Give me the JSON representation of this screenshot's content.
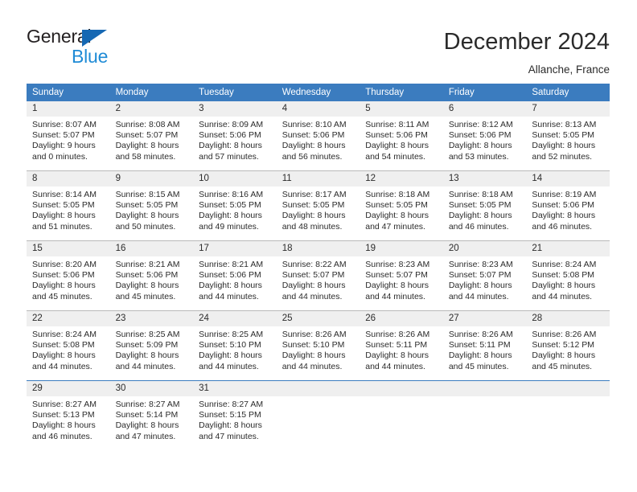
{
  "brand": {
    "name_part1": "General",
    "name_part2": "Blue",
    "accent_color": "#1668b3",
    "accent_color_light": "#1f8bd6"
  },
  "header": {
    "title": "December 2024",
    "location": "Allanche, France"
  },
  "theme": {
    "header_bg": "#3b7cbf",
    "daynum_bg": "#efefef",
    "text": "#2b2b2b",
    "grid_line": "#b9b9b9"
  },
  "weekday_headers": [
    "Sunday",
    "Monday",
    "Tuesday",
    "Wednesday",
    "Thursday",
    "Friday",
    "Saturday"
  ],
  "weeks": [
    [
      {
        "day": "1",
        "sunrise": "Sunrise: 8:07 AM",
        "sunset": "Sunset: 5:07 PM",
        "daylight1": "Daylight: 9 hours",
        "daylight2": "and 0 minutes."
      },
      {
        "day": "2",
        "sunrise": "Sunrise: 8:08 AM",
        "sunset": "Sunset: 5:07 PM",
        "daylight1": "Daylight: 8 hours",
        "daylight2": "and 58 minutes."
      },
      {
        "day": "3",
        "sunrise": "Sunrise: 8:09 AM",
        "sunset": "Sunset: 5:06 PM",
        "daylight1": "Daylight: 8 hours",
        "daylight2": "and 57 minutes."
      },
      {
        "day": "4",
        "sunrise": "Sunrise: 8:10 AM",
        "sunset": "Sunset: 5:06 PM",
        "daylight1": "Daylight: 8 hours",
        "daylight2": "and 56 minutes."
      },
      {
        "day": "5",
        "sunrise": "Sunrise: 8:11 AM",
        "sunset": "Sunset: 5:06 PM",
        "daylight1": "Daylight: 8 hours",
        "daylight2": "and 54 minutes."
      },
      {
        "day": "6",
        "sunrise": "Sunrise: 8:12 AM",
        "sunset": "Sunset: 5:06 PM",
        "daylight1": "Daylight: 8 hours",
        "daylight2": "and 53 minutes."
      },
      {
        "day": "7",
        "sunrise": "Sunrise: 8:13 AM",
        "sunset": "Sunset: 5:05 PM",
        "daylight1": "Daylight: 8 hours",
        "daylight2": "and 52 minutes."
      }
    ],
    [
      {
        "day": "8",
        "sunrise": "Sunrise: 8:14 AM",
        "sunset": "Sunset: 5:05 PM",
        "daylight1": "Daylight: 8 hours",
        "daylight2": "and 51 minutes."
      },
      {
        "day": "9",
        "sunrise": "Sunrise: 8:15 AM",
        "sunset": "Sunset: 5:05 PM",
        "daylight1": "Daylight: 8 hours",
        "daylight2": "and 50 minutes."
      },
      {
        "day": "10",
        "sunrise": "Sunrise: 8:16 AM",
        "sunset": "Sunset: 5:05 PM",
        "daylight1": "Daylight: 8 hours",
        "daylight2": "and 49 minutes."
      },
      {
        "day": "11",
        "sunrise": "Sunrise: 8:17 AM",
        "sunset": "Sunset: 5:05 PM",
        "daylight1": "Daylight: 8 hours",
        "daylight2": "and 48 minutes."
      },
      {
        "day": "12",
        "sunrise": "Sunrise: 8:18 AM",
        "sunset": "Sunset: 5:05 PM",
        "daylight1": "Daylight: 8 hours",
        "daylight2": "and 47 minutes."
      },
      {
        "day": "13",
        "sunrise": "Sunrise: 8:18 AM",
        "sunset": "Sunset: 5:05 PM",
        "daylight1": "Daylight: 8 hours",
        "daylight2": "and 46 minutes."
      },
      {
        "day": "14",
        "sunrise": "Sunrise: 8:19 AM",
        "sunset": "Sunset: 5:06 PM",
        "daylight1": "Daylight: 8 hours",
        "daylight2": "and 46 minutes."
      }
    ],
    [
      {
        "day": "15",
        "sunrise": "Sunrise: 8:20 AM",
        "sunset": "Sunset: 5:06 PM",
        "daylight1": "Daylight: 8 hours",
        "daylight2": "and 45 minutes."
      },
      {
        "day": "16",
        "sunrise": "Sunrise: 8:21 AM",
        "sunset": "Sunset: 5:06 PM",
        "daylight1": "Daylight: 8 hours",
        "daylight2": "and 45 minutes."
      },
      {
        "day": "17",
        "sunrise": "Sunrise: 8:21 AM",
        "sunset": "Sunset: 5:06 PM",
        "daylight1": "Daylight: 8 hours",
        "daylight2": "and 44 minutes."
      },
      {
        "day": "18",
        "sunrise": "Sunrise: 8:22 AM",
        "sunset": "Sunset: 5:07 PM",
        "daylight1": "Daylight: 8 hours",
        "daylight2": "and 44 minutes."
      },
      {
        "day": "19",
        "sunrise": "Sunrise: 8:23 AM",
        "sunset": "Sunset: 5:07 PM",
        "daylight1": "Daylight: 8 hours",
        "daylight2": "and 44 minutes."
      },
      {
        "day": "20",
        "sunrise": "Sunrise: 8:23 AM",
        "sunset": "Sunset: 5:07 PM",
        "daylight1": "Daylight: 8 hours",
        "daylight2": "and 44 minutes."
      },
      {
        "day": "21",
        "sunrise": "Sunrise: 8:24 AM",
        "sunset": "Sunset: 5:08 PM",
        "daylight1": "Daylight: 8 hours",
        "daylight2": "and 44 minutes."
      }
    ],
    [
      {
        "day": "22",
        "sunrise": "Sunrise: 8:24 AM",
        "sunset": "Sunset: 5:08 PM",
        "daylight1": "Daylight: 8 hours",
        "daylight2": "and 44 minutes."
      },
      {
        "day": "23",
        "sunrise": "Sunrise: 8:25 AM",
        "sunset": "Sunset: 5:09 PM",
        "daylight1": "Daylight: 8 hours",
        "daylight2": "and 44 minutes."
      },
      {
        "day": "24",
        "sunrise": "Sunrise: 8:25 AM",
        "sunset": "Sunset: 5:10 PM",
        "daylight1": "Daylight: 8 hours",
        "daylight2": "and 44 minutes."
      },
      {
        "day": "25",
        "sunrise": "Sunrise: 8:26 AM",
        "sunset": "Sunset: 5:10 PM",
        "daylight1": "Daylight: 8 hours",
        "daylight2": "and 44 minutes."
      },
      {
        "day": "26",
        "sunrise": "Sunrise: 8:26 AM",
        "sunset": "Sunset: 5:11 PM",
        "daylight1": "Daylight: 8 hours",
        "daylight2": "and 44 minutes."
      },
      {
        "day": "27",
        "sunrise": "Sunrise: 8:26 AM",
        "sunset": "Sunset: 5:11 PM",
        "daylight1": "Daylight: 8 hours",
        "daylight2": "and 45 minutes."
      },
      {
        "day": "28",
        "sunrise": "Sunrise: 8:26 AM",
        "sunset": "Sunset: 5:12 PM",
        "daylight1": "Daylight: 8 hours",
        "daylight2": "and 45 minutes."
      }
    ],
    [
      {
        "day": "29",
        "sunrise": "Sunrise: 8:27 AM",
        "sunset": "Sunset: 5:13 PM",
        "daylight1": "Daylight: 8 hours",
        "daylight2": "and 46 minutes."
      },
      {
        "day": "30",
        "sunrise": "Sunrise: 8:27 AM",
        "sunset": "Sunset: 5:14 PM",
        "daylight1": "Daylight: 8 hours",
        "daylight2": "and 47 minutes."
      },
      {
        "day": "31",
        "sunrise": "Sunrise: 8:27 AM",
        "sunset": "Sunset: 5:15 PM",
        "daylight1": "Daylight: 8 hours",
        "daylight2": "and 47 minutes."
      },
      {
        "day": "",
        "sunrise": "",
        "sunset": "",
        "daylight1": "",
        "daylight2": ""
      },
      {
        "day": "",
        "sunrise": "",
        "sunset": "",
        "daylight1": "",
        "daylight2": ""
      },
      {
        "day": "",
        "sunrise": "",
        "sunset": "",
        "daylight1": "",
        "daylight2": ""
      },
      {
        "day": "",
        "sunrise": "",
        "sunset": "",
        "daylight1": "",
        "daylight2": ""
      }
    ]
  ]
}
